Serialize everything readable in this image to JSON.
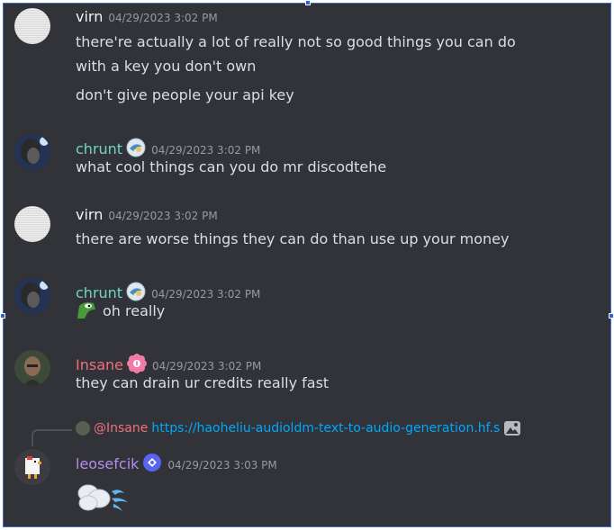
{
  "messages": [
    {
      "author": "virn",
      "timestamp": "04/29/2023 3:02 PM",
      "name_color": "#f2f3f5",
      "lines": [
        "there're actually a lot of really not so good things you can do",
        "with a key you don't own",
        "don't give people your api key"
      ]
    },
    {
      "author": "chrunt",
      "timestamp": "04/29/2023 3:02 PM",
      "name_color": "#6fd6c7",
      "lines": [
        "what cool things can you do mr discodtehe"
      ]
    },
    {
      "author": "virn",
      "timestamp": "04/29/2023 3:02 PM",
      "name_color": "#f2f3f5",
      "lines": [
        "there are worse things they can do than use up your money"
      ]
    },
    {
      "author": "chrunt",
      "timestamp": "04/29/2023 3:02 PM",
      "name_color": "#6fd6c7",
      "lines": [
        "oh really"
      ]
    },
    {
      "author": "Insane",
      "timestamp": "04/29/2023 3:02 PM",
      "name_color": "#f0707e",
      "lines": [
        "they can drain ur credits really fast"
      ]
    },
    {
      "author": "leosefcik",
      "timestamp": "04/29/2023 3:03 PM",
      "name_color": "#b58cf0",
      "reply": {
        "mention": "@Insane",
        "link": "https://haoheliu-audioldm-text-to-audio-generation.hf.s"
      }
    }
  ],
  "colors": {
    "background": "#313338",
    "text": "#dbdee1",
    "timestamp": "#949ba4",
    "link": "#00a8fc",
    "selection": "#2f62d6"
  },
  "icons": [
    "pepe-frog-icon",
    "flower-role-badge-icon",
    "nitro-badge-icon",
    "image-attachment-icon",
    "dash-emoji-icon"
  ]
}
